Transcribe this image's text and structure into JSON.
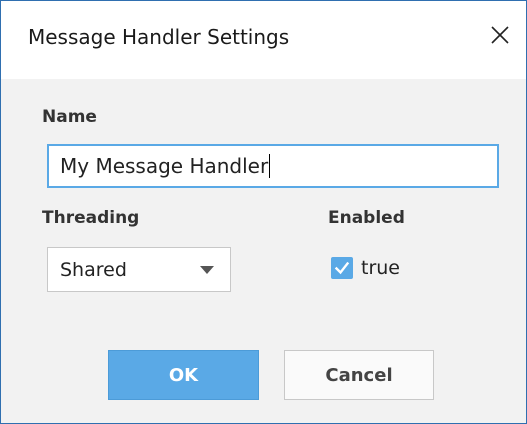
{
  "dialog": {
    "title": "Message Handler Settings"
  },
  "icons": {
    "close": "close-icon",
    "dropdown": "chevron-down-icon",
    "check": "checkmark-icon"
  },
  "colors": {
    "accent": "#5aa9e6",
    "body_background": "#f2f2f2",
    "window_border": "#2f6fb0"
  },
  "form": {
    "name_label": "Name",
    "name_value": "My Message Handler",
    "threading_label": "Threading",
    "threading_value": "Shared",
    "enabled_label": "Enabled",
    "enabled_checked": true,
    "enabled_text": "true"
  },
  "buttons": {
    "ok_label": "OK",
    "cancel_label": "Cancel"
  }
}
